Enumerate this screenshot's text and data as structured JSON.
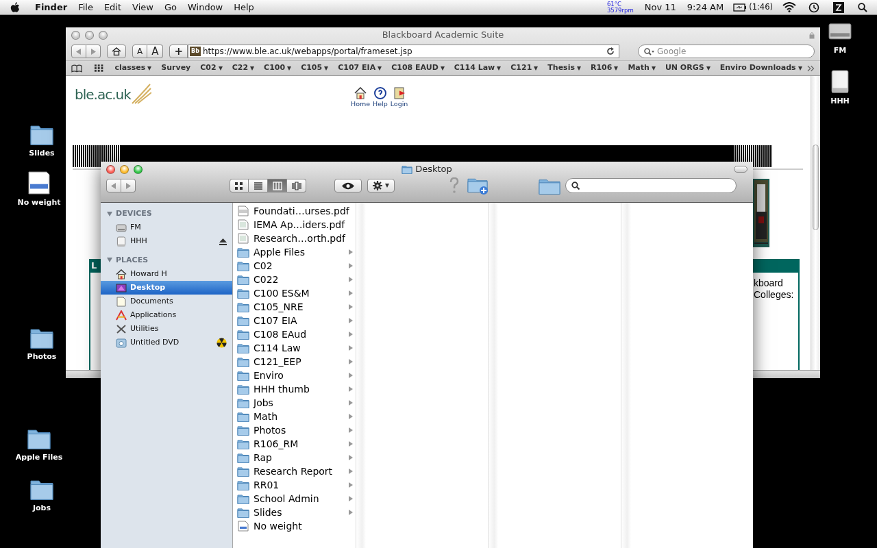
{
  "menubar": {
    "app": "Finder",
    "menus": [
      "File",
      "Edit",
      "View",
      "Go",
      "Window",
      "Help"
    ],
    "sensor": [
      "61°C",
      "3579rpm"
    ],
    "date": "Nov 11",
    "time": "9:24 AM",
    "battery": "(1:46)"
  },
  "desktop_icons": [
    {
      "label": "FM",
      "kind": "disk"
    },
    {
      "label": "HHH",
      "kind": "drive"
    },
    {
      "label": "Slides",
      "kind": "folder"
    },
    {
      "label": "No weight",
      "kind": "document"
    },
    {
      "label": "Photos",
      "kind": "folder"
    },
    {
      "label": "Apple Files",
      "kind": "folder"
    },
    {
      "label": "Jobs",
      "kind": "folder"
    }
  ],
  "browser": {
    "title": "Blackboard Academic Suite",
    "active": false,
    "text_sizes": [
      "A",
      "A"
    ],
    "add_label": "+",
    "url": "https://www.ble.ac.uk/webapps/portal/frameset.jsp",
    "favicon": "Bb",
    "search_placeholder": "Google",
    "bookmarks": [
      {
        "label": "classes",
        "menu": true
      },
      {
        "label": "Survey",
        "menu": false
      },
      {
        "label": "C02",
        "menu": true
      },
      {
        "label": "C22",
        "menu": true
      },
      {
        "label": "C100",
        "menu": true
      },
      {
        "label": "C105",
        "menu": true
      },
      {
        "label": "C107 EIA",
        "menu": true
      },
      {
        "label": "C108 EAUD",
        "menu": true
      },
      {
        "label": "C114 Law",
        "menu": true
      },
      {
        "label": "C121",
        "menu": true
      },
      {
        "label": "Thesis",
        "menu": true
      },
      {
        "label": "R106",
        "menu": true
      },
      {
        "label": "Math",
        "menu": true
      },
      {
        "label": "UN ORGS",
        "menu": true
      },
      {
        "label": "Enviro Downloads",
        "menu": true
      }
    ],
    "page": {
      "logo": "ble.ac.uk",
      "nav": [
        {
          "label": "Home",
          "kind": "home"
        },
        {
          "label": "Help",
          "kind": "help"
        },
        {
          "label": "Login",
          "kind": "login"
        }
      ],
      "left_header": "L",
      "right_lines": [
        "kboard",
        "Colleges:"
      ]
    }
  },
  "finder": {
    "title": "Desktop",
    "active": true,
    "view_modes": [
      {
        "kind": "icon",
        "selected": false
      },
      {
        "kind": "list",
        "selected": false
      },
      {
        "kind": "columns",
        "selected": true
      },
      {
        "kind": "coverflow",
        "selected": false
      }
    ],
    "sidebar": [
      {
        "heading": "DEVICES",
        "items": [
          {
            "label": "FM",
            "kind": "disk",
            "selected": false
          },
          {
            "label": "HHH",
            "kind": "drive",
            "selected": false,
            "eject": true
          }
        ]
      },
      {
        "heading": "PLACES",
        "items": [
          {
            "label": "Howard H",
            "kind": "home",
            "selected": false
          },
          {
            "label": "Desktop",
            "kind": "desktop",
            "selected": true
          },
          {
            "label": "Documents",
            "kind": "documents",
            "selected": false
          },
          {
            "label": "Applications",
            "kind": "applications",
            "selected": false
          },
          {
            "label": "Utilities",
            "kind": "utilities",
            "selected": false
          },
          {
            "label": "Untitled DVD",
            "kind": "dvd",
            "selected": false,
            "burn": true
          }
        ]
      }
    ],
    "files": [
      {
        "name": "Foundati…urses.pdf",
        "kind": "pdf"
      },
      {
        "name": "IEMA Ap…iders.pdf",
        "kind": "document"
      },
      {
        "name": "Research…orth.pdf",
        "kind": "document"
      },
      {
        "name": "Apple Files",
        "kind": "folder"
      },
      {
        "name": "C02",
        "kind": "folder"
      },
      {
        "name": "C022",
        "kind": "folder"
      },
      {
        "name": "C100 ES&M",
        "kind": "folder"
      },
      {
        "name": "C105_NRE",
        "kind": "folder"
      },
      {
        "name": "C107 EIA",
        "kind": "folder"
      },
      {
        "name": "C108 EAud",
        "kind": "folder"
      },
      {
        "name": "C114 Law",
        "kind": "folder"
      },
      {
        "name": "C121_EEP",
        "kind": "folder"
      },
      {
        "name": "Enviro",
        "kind": "folder"
      },
      {
        "name": "HHH thumb",
        "kind": "folder"
      },
      {
        "name": "Jobs",
        "kind": "folder"
      },
      {
        "name": "Math",
        "kind": "folder"
      },
      {
        "name": "Photos",
        "kind": "folder"
      },
      {
        "name": "R106_RM",
        "kind": "folder"
      },
      {
        "name": "Rap",
        "kind": "folder"
      },
      {
        "name": "Research Report",
        "kind": "folder"
      },
      {
        "name": "RR01",
        "kind": "folder"
      },
      {
        "name": "School Admin",
        "kind": "folder"
      },
      {
        "name": "Slides",
        "kind": "folder"
      },
      {
        "name": "No weight",
        "kind": "note"
      }
    ]
  }
}
